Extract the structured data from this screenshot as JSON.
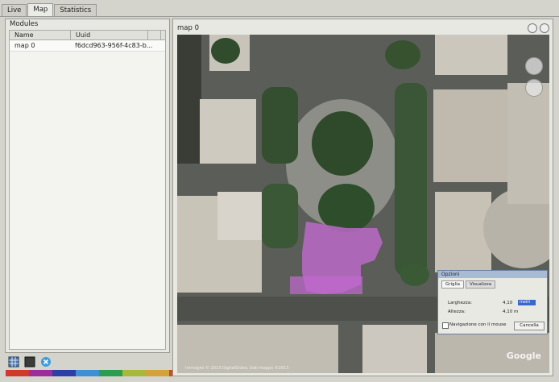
{
  "tabs": [
    {
      "label": "Live"
    },
    {
      "label": "Map"
    },
    {
      "label": "Statistics"
    }
  ],
  "modules": {
    "title": "Modules",
    "columns": [
      "Name",
      "Uuid"
    ],
    "rows": [
      {
        "name": "map 0",
        "uuid": "f6dcd963-956f-4c83-b..."
      }
    ]
  },
  "map": {
    "title": "map 0",
    "attribution": "Immagini © 2013 DigitalGlobe, Dati mappa ©2013",
    "logo": "Google"
  },
  "dialog": {
    "title": "Opzioni",
    "tabs": [
      "Griglia",
      "Visualizza"
    ],
    "fields": [
      {
        "label": "Larghezza:",
        "value": "4,10",
        "unit": "metri"
      },
      {
        "label": "Altezza:",
        "value": "4,10 m"
      }
    ],
    "checkbox_label": "Navigazione con il mouse",
    "button_label": "Cancella"
  },
  "colors": {
    "strip": [
      "#d03a2d",
      "#9b2e9b",
      "#2d3ea8",
      "#3f8fd4",
      "#2a9d4e",
      "#a7b83b",
      "#d3a23a",
      "#c54f2a",
      "#b82027"
    ]
  }
}
